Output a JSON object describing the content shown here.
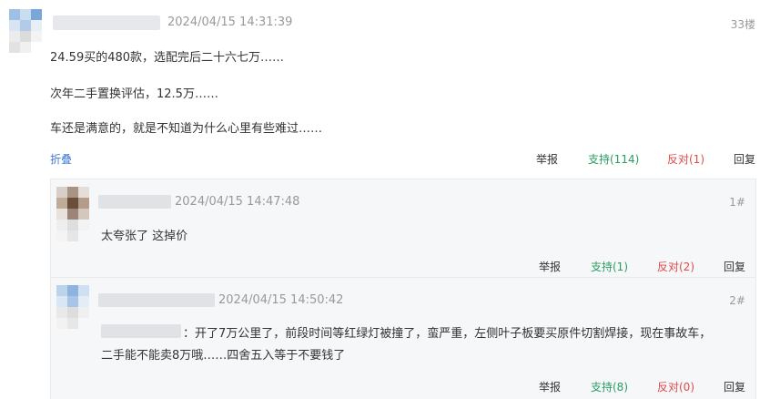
{
  "main_post": {
    "timestamp": "2024/04/15 14:31:39",
    "floor": "33楼",
    "lines": [
      "24.59买的480款，选配完后二十六七万……",
      "次年二手置换评估，12.5万……",
      "车还是满意的，就是不知道为什么心里有些难过……"
    ],
    "collapse_label": "折叠",
    "actions": {
      "report": "举报",
      "support": "支持(114)",
      "oppose": "反对(1)",
      "reply": "回复"
    }
  },
  "replies": [
    {
      "timestamp": "2024/04/15 14:47:48",
      "floor": "1#",
      "text": "太夸张了 这掉价",
      "actions": {
        "report": "举报",
        "support": "支持(1)",
        "oppose": "反对(2)",
        "reply": "回复"
      }
    },
    {
      "timestamp": "2024/04/15 14:50:42",
      "floor": "2#",
      "text_line1": "：开了7万公里了，前段时间等红绿灯被撞了，蛮严重，左侧叶子板要买原件切割焊接，现在事故车，",
      "text_line2": "二手能不能卖8万哦……四舍五入等于不要钱了",
      "actions": {
        "report": "举报",
        "support": "支持(8)",
        "oppose": "反对(0)",
        "reply": "回复"
      }
    }
  ],
  "colors": {
    "support": "#2a9d62",
    "oppose": "#e04a4a",
    "link": "#3e79d6",
    "muted": "#999999"
  }
}
